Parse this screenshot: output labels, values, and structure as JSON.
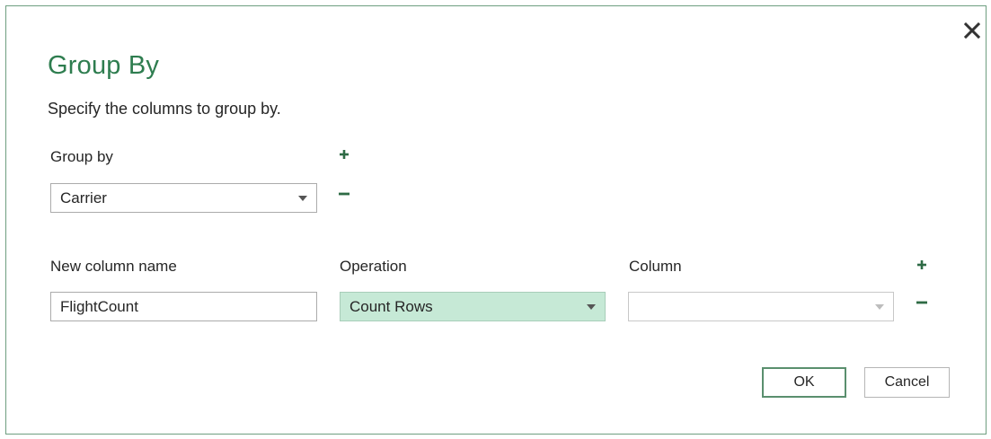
{
  "dialog": {
    "title": "Group By",
    "subtitle": "Specify the columns to group by.",
    "close_icon": "close-icon"
  },
  "group_by": {
    "label": "Group by",
    "selected": "Carrier",
    "add_icon": "plus-icon",
    "remove_icon": "minus-icon"
  },
  "aggregation": {
    "new_column_label": "New column name",
    "new_column_value": "FlightCount",
    "operation_label": "Operation",
    "operation_selected": "Count Rows",
    "column_label": "Column",
    "column_selected": "",
    "add_icon": "plus-icon",
    "remove_icon": "minus-icon"
  },
  "buttons": {
    "ok": "OK",
    "cancel": "Cancel"
  },
  "colors": {
    "accent": "#2e7d4f",
    "highlight": "#c6e9d6",
    "ok_border": "#5a8f6e"
  }
}
